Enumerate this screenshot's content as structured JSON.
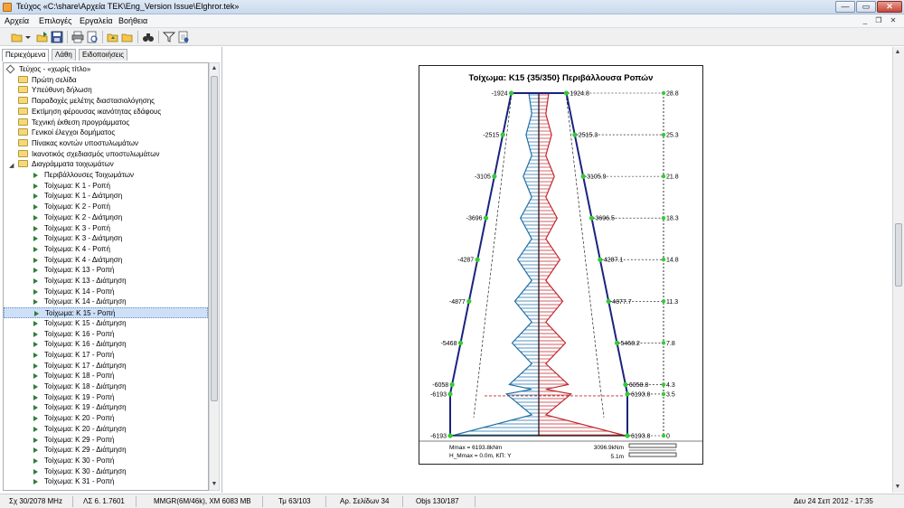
{
  "window": {
    "title": "Τεύχος «C:\\share\\Αρχεία TEK\\Eng_Version Issue\\Elghror.tek»",
    "min_label": "—",
    "max_label": "▭",
    "close_label": "✕"
  },
  "menu": {
    "items": [
      "Αρχεία",
      "Επιλογές",
      "Εργαλεία",
      "Βοήθεια"
    ]
  },
  "tabs": [
    "Περιεχόμενα",
    "Λάθη",
    "Ειδοποιήσεις"
  ],
  "tree": {
    "root": "Τεύχος - «χωρίς τίτλο»",
    "folders": [
      "Πρώτη σελίδα",
      "Υπεύθυνη δήλωση",
      "Παραδοχές μελέτης διαστασιολόγησης",
      "Εκτίμηση φέρουσας ικανότητας εδάφους",
      "Τεχνική έκθεση προγράμματος",
      "Γενικοί έλεγχοι δομήματος",
      "Πίνακας κοντών υποστυλωμάτων",
      "Ικανοτικός σχεδιασμός υποστυλωμάτων",
      "Διαγράμματα τοιχωμάτων"
    ],
    "children": [
      "Περιβάλλουσες Τοιχωμάτων",
      "Τοίχωμα: Κ 1 - Ροπή",
      "Τοίχωμα: Κ 1 - Διάτμηση",
      "Τοίχωμα: Κ 2 - Ροπή",
      "Τοίχωμα: Κ 2 - Διάτμηση",
      "Τοίχωμα: Κ 3 - Ροπή",
      "Τοίχωμα: Κ 3 - Διάτμηση",
      "Τοίχωμα: Κ 4 - Ροπή",
      "Τοίχωμα: Κ 4 - Διάτμηση",
      "Τοίχωμα: Κ 13 - Ροπή",
      "Τοίχωμα: Κ 13 - Διάτμηση",
      "Τοίχωμα: Κ 14 - Ροπή",
      "Τοίχωμα: Κ 14 - Διάτμηση",
      "Τοίχωμα: Κ 15 - Ροπή",
      "Τοίχωμα: Κ 15 - Διάτμηση",
      "Τοίχωμα: Κ 16 - Ροπή",
      "Τοίχωμα: Κ 16 - Διάτμηση",
      "Τοίχωμα: Κ 17 - Ροπή",
      "Τοίχωμα: Κ 17 - Διάτμηση",
      "Τοίχωμα: Κ 18 - Ροπή",
      "Τοίχωμα: Κ 18 - Διάτμηση",
      "Τοίχωμα: Κ 19 - Ροπή",
      "Τοίχωμα: Κ 19 - Διάτμηση",
      "Τοίχωμα: Κ 20 - Ροπή",
      "Τοίχωμα: Κ 20 - Διάτμηση",
      "Τοίχωμα: Κ 29 - Ροπή",
      "Τοίχωμα: Κ 29 - Διάτμηση",
      "Τοίχωμα: Κ 30 - Ροπή",
      "Τοίχωμα: Κ 30 - Διάτμηση",
      "Τοίχωμα: Κ 31 - Ροπή"
    ],
    "selected_child": "Τοίχωμα: Κ 15 - Ροπή"
  },
  "diagram": {
    "title": "Τοίχωμα: Κ15 {35/350} Περιβάλλουσα Ροπών",
    "levels": [
      {
        "left": "-1924",
        "right": "1924.8",
        "elev": "28.8"
      },
      {
        "left": "-2515",
        "right": "2515.3",
        "elev": "25.3"
      },
      {
        "left": "-3105",
        "right": "3105.9",
        "elev": "21.8"
      },
      {
        "left": "-3696",
        "right": "3696.5",
        "elev": "18.3"
      },
      {
        "left": "-4287",
        "right": "4287.1",
        "elev": "14.8"
      },
      {
        "left": "-4877",
        "right": "4877.7",
        "elev": "11.3"
      },
      {
        "left": "-5468",
        "right": "5468.2",
        "elev": "7.8"
      },
      {
        "left": "-6058",
        "right": "6058.8",
        "elev": "4.3"
      },
      {
        "left": "-6193",
        "right": "6193.8",
        "elev": "3.5"
      },
      {
        "left": "-6193",
        "right": "6193.8",
        "elev": "0"
      }
    ],
    "footer_left_1": "Mmax = 6193.8kNm",
    "footer_left_2": "H_Mmax = 0.0m, ΚΠ: Y",
    "footer_right_1": "3096.9kNm",
    "footer_right_2": "5.1m",
    "colors": {
      "envelope": "#1a237e",
      "negative": "#1f6fa8",
      "positive": "#c0272d",
      "node": "#33cc33"
    }
  },
  "status": {
    "cells": [
      "Σχ 30/2078 MHz",
      "ΛΣ 6. 1.7601",
      "MMGR(6M/46k), XM 6083 MB",
      "Τμ 63/103",
      "Αρ. Σελίδων 34",
      "Objs 130/187",
      "Δευ 24 Σεπ 2012 - 17:35"
    ]
  }
}
